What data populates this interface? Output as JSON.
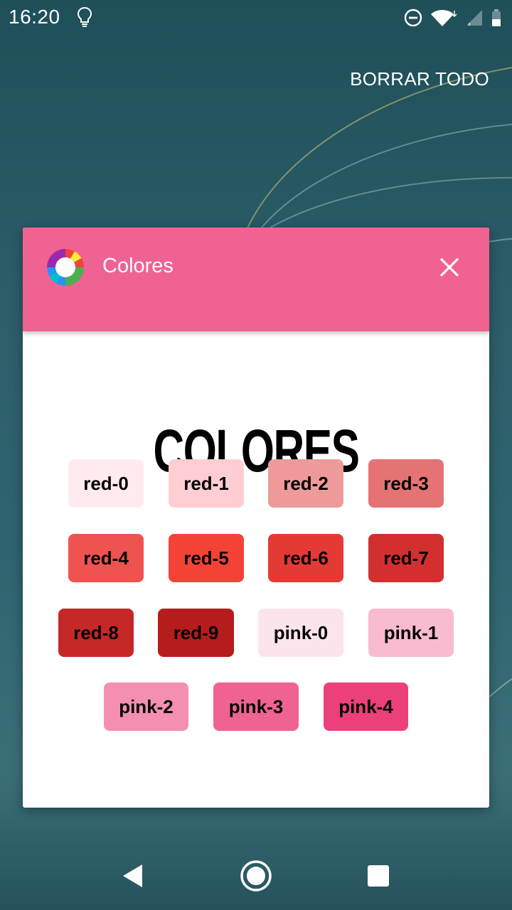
{
  "status_bar": {
    "time": "16:20",
    "icons": [
      "lightbulb-icon",
      "do-not-disturb-icon",
      "wifi-icon",
      "signal-icon",
      "battery-icon"
    ]
  },
  "recents": {
    "clear_all_label": "BORRAR TODO"
  },
  "task_card": {
    "app_name": "Colores",
    "header_color": "#f06292",
    "app_icon": "color-wheel-icon",
    "close_icon": "close-icon",
    "page_title": "COLORES",
    "chips": [
      {
        "label": "red-0",
        "color": "#ffebee"
      },
      {
        "label": "red-1",
        "color": "#ffcdd2"
      },
      {
        "label": "red-2",
        "color": "#ef9a9a"
      },
      {
        "label": "red-3",
        "color": "#e57373"
      },
      {
        "label": "red-4",
        "color": "#ef5350"
      },
      {
        "label": "red-5",
        "color": "#f44336"
      },
      {
        "label": "red-6",
        "color": "#e53935"
      },
      {
        "label": "red-7",
        "color": "#d32f2f"
      },
      {
        "label": "red-8",
        "color": "#c62828"
      },
      {
        "label": "red-9",
        "color": "#b71c1c"
      },
      {
        "label": "pink-0",
        "color": "#fce4ec"
      },
      {
        "label": "pink-1",
        "color": "#f8bbd0"
      },
      {
        "label": "pink-2",
        "color": "#f48fb1"
      },
      {
        "label": "pink-3",
        "color": "#f06292"
      },
      {
        "label": "pink-4",
        "color": "#ec407a"
      }
    ]
  },
  "nav_bar": {
    "icons": [
      "back-icon",
      "home-icon",
      "recents-icon"
    ]
  }
}
